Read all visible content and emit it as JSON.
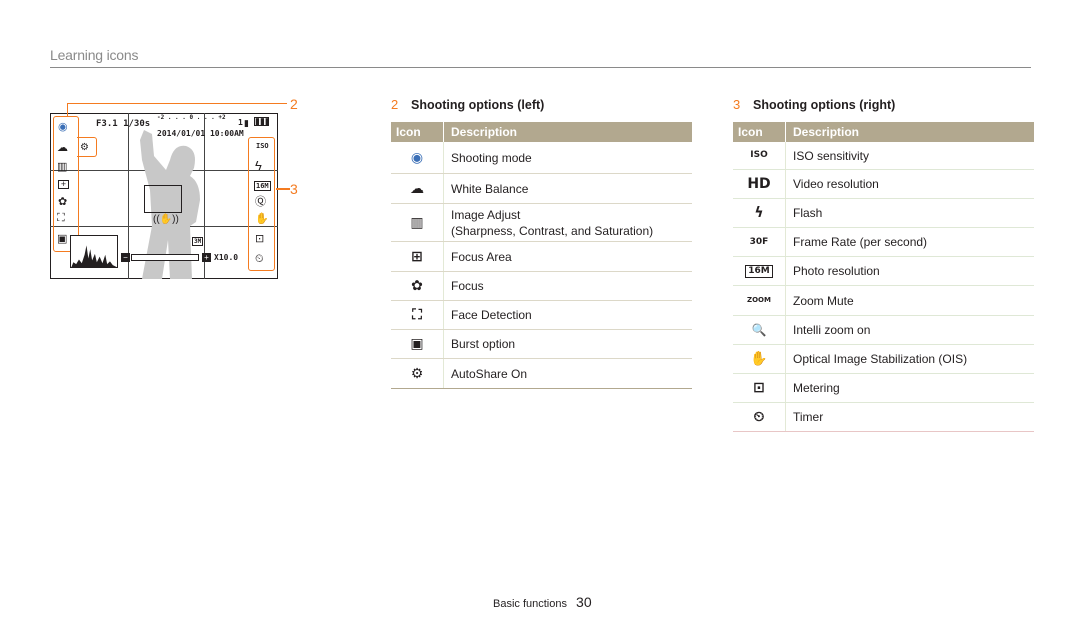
{
  "header": {
    "title": "Learning icons"
  },
  "screen": {
    "callout_2": "2",
    "callout_3": "3",
    "aperture_shutter": "F3.1  1/30s",
    "exposure_scale": "-2 . . . 0 . . . +2",
    "shots_remaining": "1",
    "datetime": "2014/01/01  10:00AM",
    "zoom_level": "X10.0",
    "left_icons": [
      "camera-p-icon",
      "cloud-icon",
      "autoshare-icon",
      "image-adjust-icon",
      "focus-area-icon",
      "macro-flower-icon",
      "face-detection-icon",
      "burst-icon"
    ],
    "right_icons": [
      "iso-icon",
      "flash-icon",
      "photo-resolution-icon",
      "intelli-zoom-icon",
      "ois-icon",
      "metering-icon",
      "timer-icon"
    ]
  },
  "left_table": {
    "number": "2",
    "title": "Shooting options (left)",
    "col_icon": "Icon",
    "col_desc": "Description",
    "rows": [
      {
        "icon": "shooting-mode-icon",
        "glyph": "◉",
        "desc": "Shooting mode"
      },
      {
        "icon": "white-balance-icon",
        "glyph": "☁",
        "desc": "White Balance"
      },
      {
        "icon": "image-adjust-icon",
        "glyph": "▥",
        "desc": "Image Adjust",
        "desc2": "(Sharpness, Contrast, and Saturation)"
      },
      {
        "icon": "focus-area-icon",
        "glyph": "⊞",
        "desc": "Focus Area"
      },
      {
        "icon": "focus-icon",
        "glyph": "✿",
        "desc": "Focus"
      },
      {
        "icon": "face-detection-icon",
        "glyph": "⛶",
        "desc": "Face Detection"
      },
      {
        "icon": "burst-option-icon",
        "glyph": "▣",
        "desc": "Burst option"
      },
      {
        "icon": "autoshare-icon",
        "glyph": "⚙",
        "desc": "AutoShare On"
      }
    ]
  },
  "right_table": {
    "number": "3",
    "title": "Shooting options (right)",
    "col_icon": "Icon",
    "col_desc": "Description",
    "rows": [
      {
        "icon": "iso-icon",
        "glyph": "ISO",
        "desc": "ISO sensitivity"
      },
      {
        "icon": "hd-icon",
        "glyph": "HD",
        "desc": "Video resolution"
      },
      {
        "icon": "flash-icon",
        "glyph": "ϟ",
        "desc": "Flash"
      },
      {
        "icon": "frame-rate-icon",
        "glyph": "30F",
        "desc": "Frame Rate (per second)"
      },
      {
        "icon": "photo-resolution-icon",
        "glyph": "16M",
        "desc": "Photo resolution"
      },
      {
        "icon": "zoom-mute-icon",
        "glyph": "ZOOM",
        "desc": "Zoom Mute"
      },
      {
        "icon": "intelli-zoom-icon",
        "glyph": "🔍",
        "desc": "Intelli zoom on"
      },
      {
        "icon": "ois-icon",
        "glyph": "✋",
        "desc": "Optical Image Stabilization (OIS)"
      },
      {
        "icon": "metering-icon",
        "glyph": "⊡",
        "desc": "Metering"
      },
      {
        "icon": "timer-icon",
        "glyph": "⏲",
        "desc": "Timer"
      }
    ]
  },
  "footer": {
    "section": "Basic functions",
    "page": "30"
  }
}
